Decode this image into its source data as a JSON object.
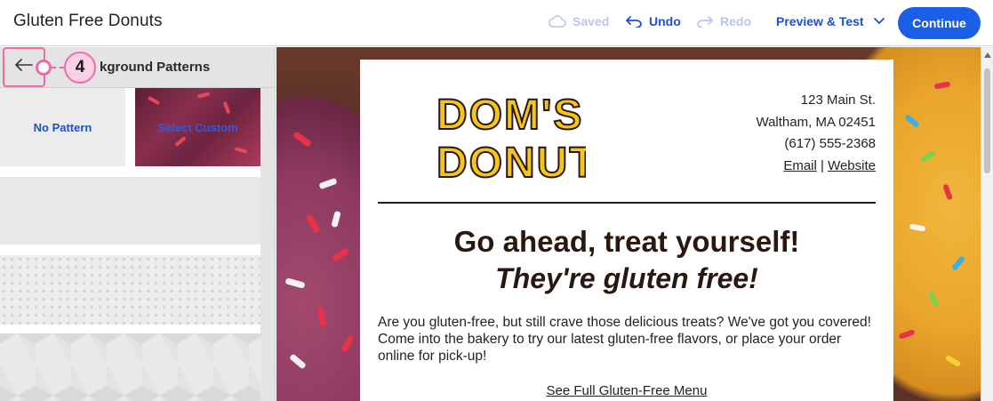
{
  "topbar": {
    "title": "Gluten Free Donuts",
    "saved_label": "Saved",
    "undo_label": "Undo",
    "redo_label": "Redo",
    "preview_label": "Preview & Test",
    "continue_label": "Continue"
  },
  "panel": {
    "title": "Background Patterns",
    "title_visible": "kground Patterns",
    "callout_number": "4",
    "tiles": {
      "no_pattern": "No Pattern",
      "select_custom": "Select Custom"
    }
  },
  "email": {
    "brand": "DOM'S DONUTS",
    "logo_line1": "DOM'S",
    "logo_line2": "DONUTS",
    "address": {
      "street": "123 Main St.",
      "city": "Waltham, MA 02451",
      "phone": "(617) 555-2368",
      "email_link": "Email",
      "separator": "|",
      "website_link": "Website"
    },
    "headline": "Go ahead, treat yourself!",
    "subhead": "They're gluten free!",
    "body": "Are you gluten-free, but still crave those delicious treats? We've got you covered! Come into the bakery to try our latest gluten-free flavors, or place your order online for pick-up!",
    "menu_link": "See Full Gluten-Free Menu"
  },
  "colors": {
    "accent": "#1a5fe6",
    "link": "#1f4fd1",
    "callout": "#f06aaa",
    "logo_yellow": "#f5c518",
    "text_dark": "#2a1810"
  },
  "icons": {
    "saved": "cloud-icon",
    "undo": "undo-arrow-icon",
    "redo": "redo-arrow-icon",
    "preview_dropdown": "chevron-down-icon",
    "back": "arrow-left-icon"
  }
}
